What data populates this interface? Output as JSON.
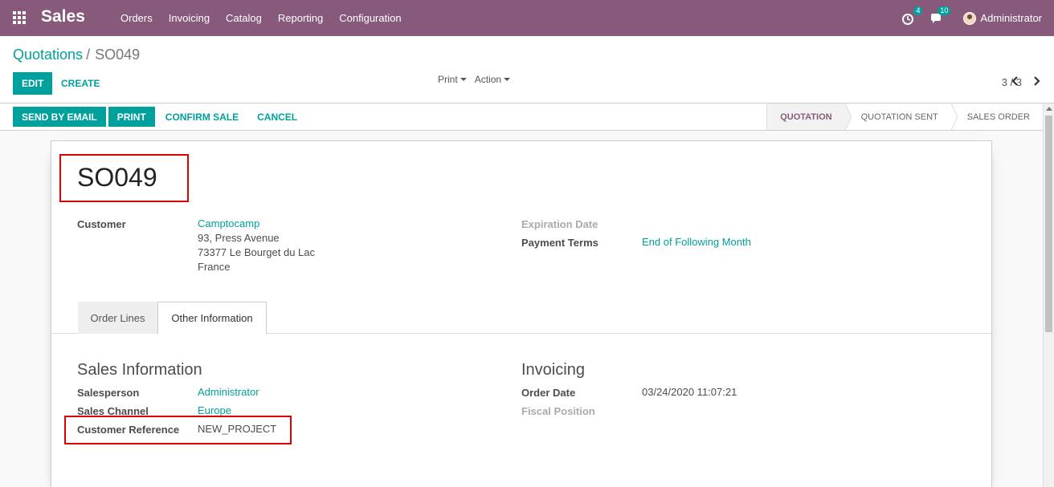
{
  "navbar": {
    "brand": "Sales",
    "menu": [
      "Orders",
      "Invoicing",
      "Catalog",
      "Reporting",
      "Configuration"
    ],
    "activity_count": "4",
    "message_count": "10",
    "user": "Administrator"
  },
  "breadcrumb": {
    "parent": "Quotations",
    "separator": "/",
    "current": "SO049"
  },
  "toolbar": {
    "edit": "EDIT",
    "create": "CREATE",
    "print_dd": "Print",
    "action_dd": "Action",
    "pager": "3 / 3"
  },
  "statusbar": {
    "buttons": [
      "SEND BY EMAIL",
      "PRINT",
      "CONFIRM SALE",
      "CANCEL"
    ],
    "stages": [
      "QUOTATION",
      "QUOTATION SENT",
      "SALES ORDER"
    ],
    "active_stage": "QUOTATION"
  },
  "record": {
    "name": "SO049",
    "customer_label": "Customer",
    "customer_name": "Camptocamp",
    "address": [
      "93, Press Avenue",
      "73377 Le Bourget du Lac",
      "France"
    ],
    "expiration_label": "Expiration Date",
    "payment_terms_label": "Payment Terms",
    "payment_terms": "End of Following Month"
  },
  "tabs": [
    "Order Lines",
    "Other Information"
  ],
  "active_tab": "Other Information",
  "other_info": {
    "sales_title": "Sales Information",
    "salesperson_label": "Salesperson",
    "salesperson": "Administrator",
    "channel_label": "Sales Channel",
    "channel": "Europe",
    "reference_label": "Customer Reference",
    "reference": "NEW_PROJECT",
    "invoicing_title": "Invoicing",
    "order_date_label": "Order Date",
    "order_date": "03/24/2020 11:07:21",
    "fiscal_label": "Fiscal Position"
  },
  "colors": {
    "navbar": "#875a7b",
    "accent": "#00a09d",
    "highlight": "#dd0000"
  }
}
